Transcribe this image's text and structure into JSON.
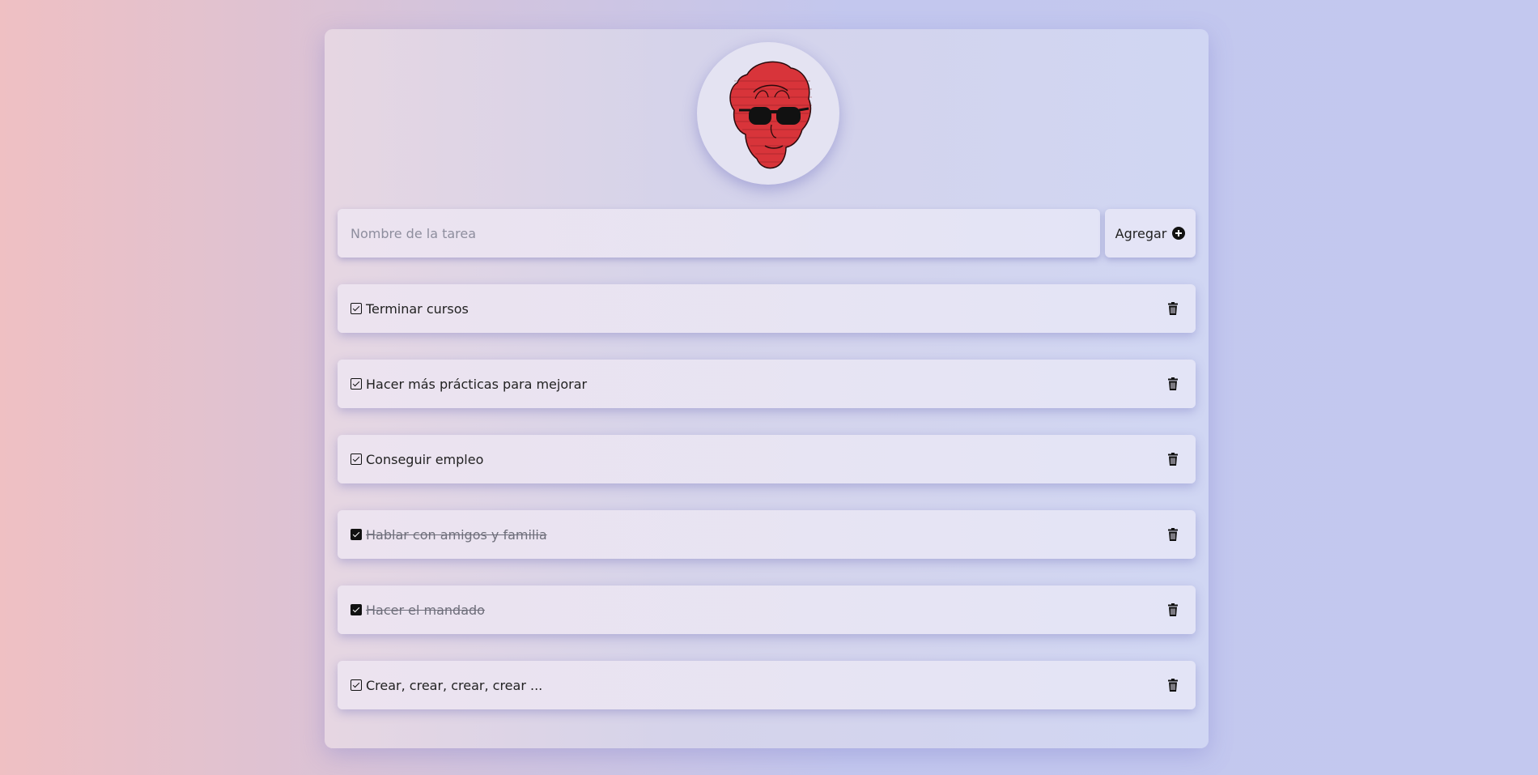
{
  "input": {
    "placeholder": "Nombre de la tarea",
    "value": ""
  },
  "add_button": {
    "label": "Agregar",
    "icon": "plus-circle-icon"
  },
  "avatar": {
    "icon": "red-face-sunglasses-avatar"
  },
  "tasks": [
    {
      "text": "Terminar cursos",
      "completed": false
    },
    {
      "text": "Hacer más prácticas para mejorar",
      "completed": false
    },
    {
      "text": "Conseguir empleo",
      "completed": false
    },
    {
      "text": "Hablar con amigos y familia",
      "completed": true
    },
    {
      "text": "Hacer el mandado",
      "completed": true
    },
    {
      "text": "Crear, crear, crear, crear ...",
      "completed": false
    }
  ],
  "colors": {
    "avatar_red": "#d8343a",
    "icon": "#111111"
  }
}
